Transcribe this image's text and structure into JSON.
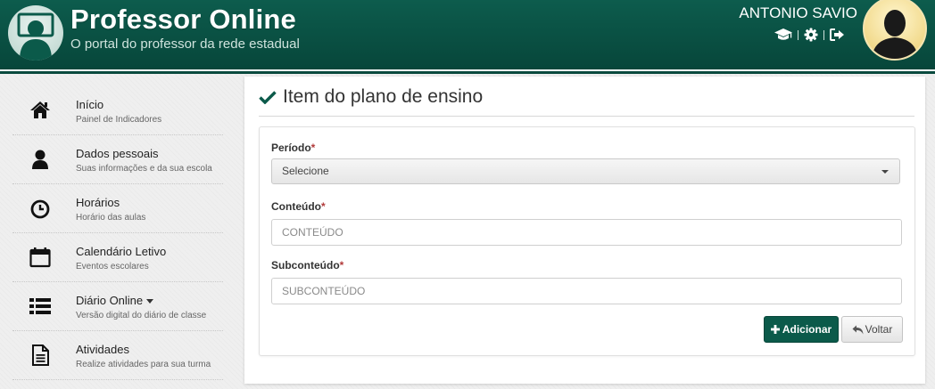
{
  "header": {
    "title": "Professor Online",
    "subtitle": "O portal do professor da rede estadual",
    "logo_icon": "teacher-logo-icon",
    "user_name": "ANTONIO SAVIO",
    "actions": [
      {
        "icon": "graduation-cap-icon"
      },
      {
        "icon": "gear-icon"
      },
      {
        "icon": "sign-out-icon"
      }
    ],
    "colors": {
      "primary": "#0b5a4a",
      "primary_dark": "#07463a"
    }
  },
  "sidebar": {
    "items": [
      {
        "icon": "home-icon",
        "label": "Início",
        "sublabel": "Painel de Indicadores"
      },
      {
        "icon": "user-icon",
        "label": "Dados pessoais",
        "sublabel": "Suas informações e da sua escola"
      },
      {
        "icon": "clock-icon",
        "label": "Horários",
        "sublabel": "Horário das aulas"
      },
      {
        "icon": "calendar-icon",
        "label": "Calendário Letivo",
        "sublabel": "Eventos escolares"
      },
      {
        "icon": "list-icon",
        "label": "Diário Online",
        "sublabel": "Versão digital do diário de classe",
        "has_dropdown": true
      },
      {
        "icon": "file-text-icon",
        "label": "Atividades",
        "sublabel": "Realize atividades para sua turma"
      }
    ]
  },
  "main": {
    "title": "Item do plano de ensino",
    "title_icon": "check-icon",
    "form": {
      "periodo": {
        "label": "Período",
        "required_mark": "*",
        "selected": "Selecione"
      },
      "conteudo": {
        "label": "Conteúdo",
        "required_mark": "*",
        "value": "",
        "placeholder": "CONTEÚDO"
      },
      "subconteudo": {
        "label": "Subconteúdo",
        "required_mark": "*",
        "value": "",
        "placeholder": "SUBCONTEÚDO"
      },
      "add_button": "Adicionar",
      "back_button": "Voltar"
    }
  }
}
